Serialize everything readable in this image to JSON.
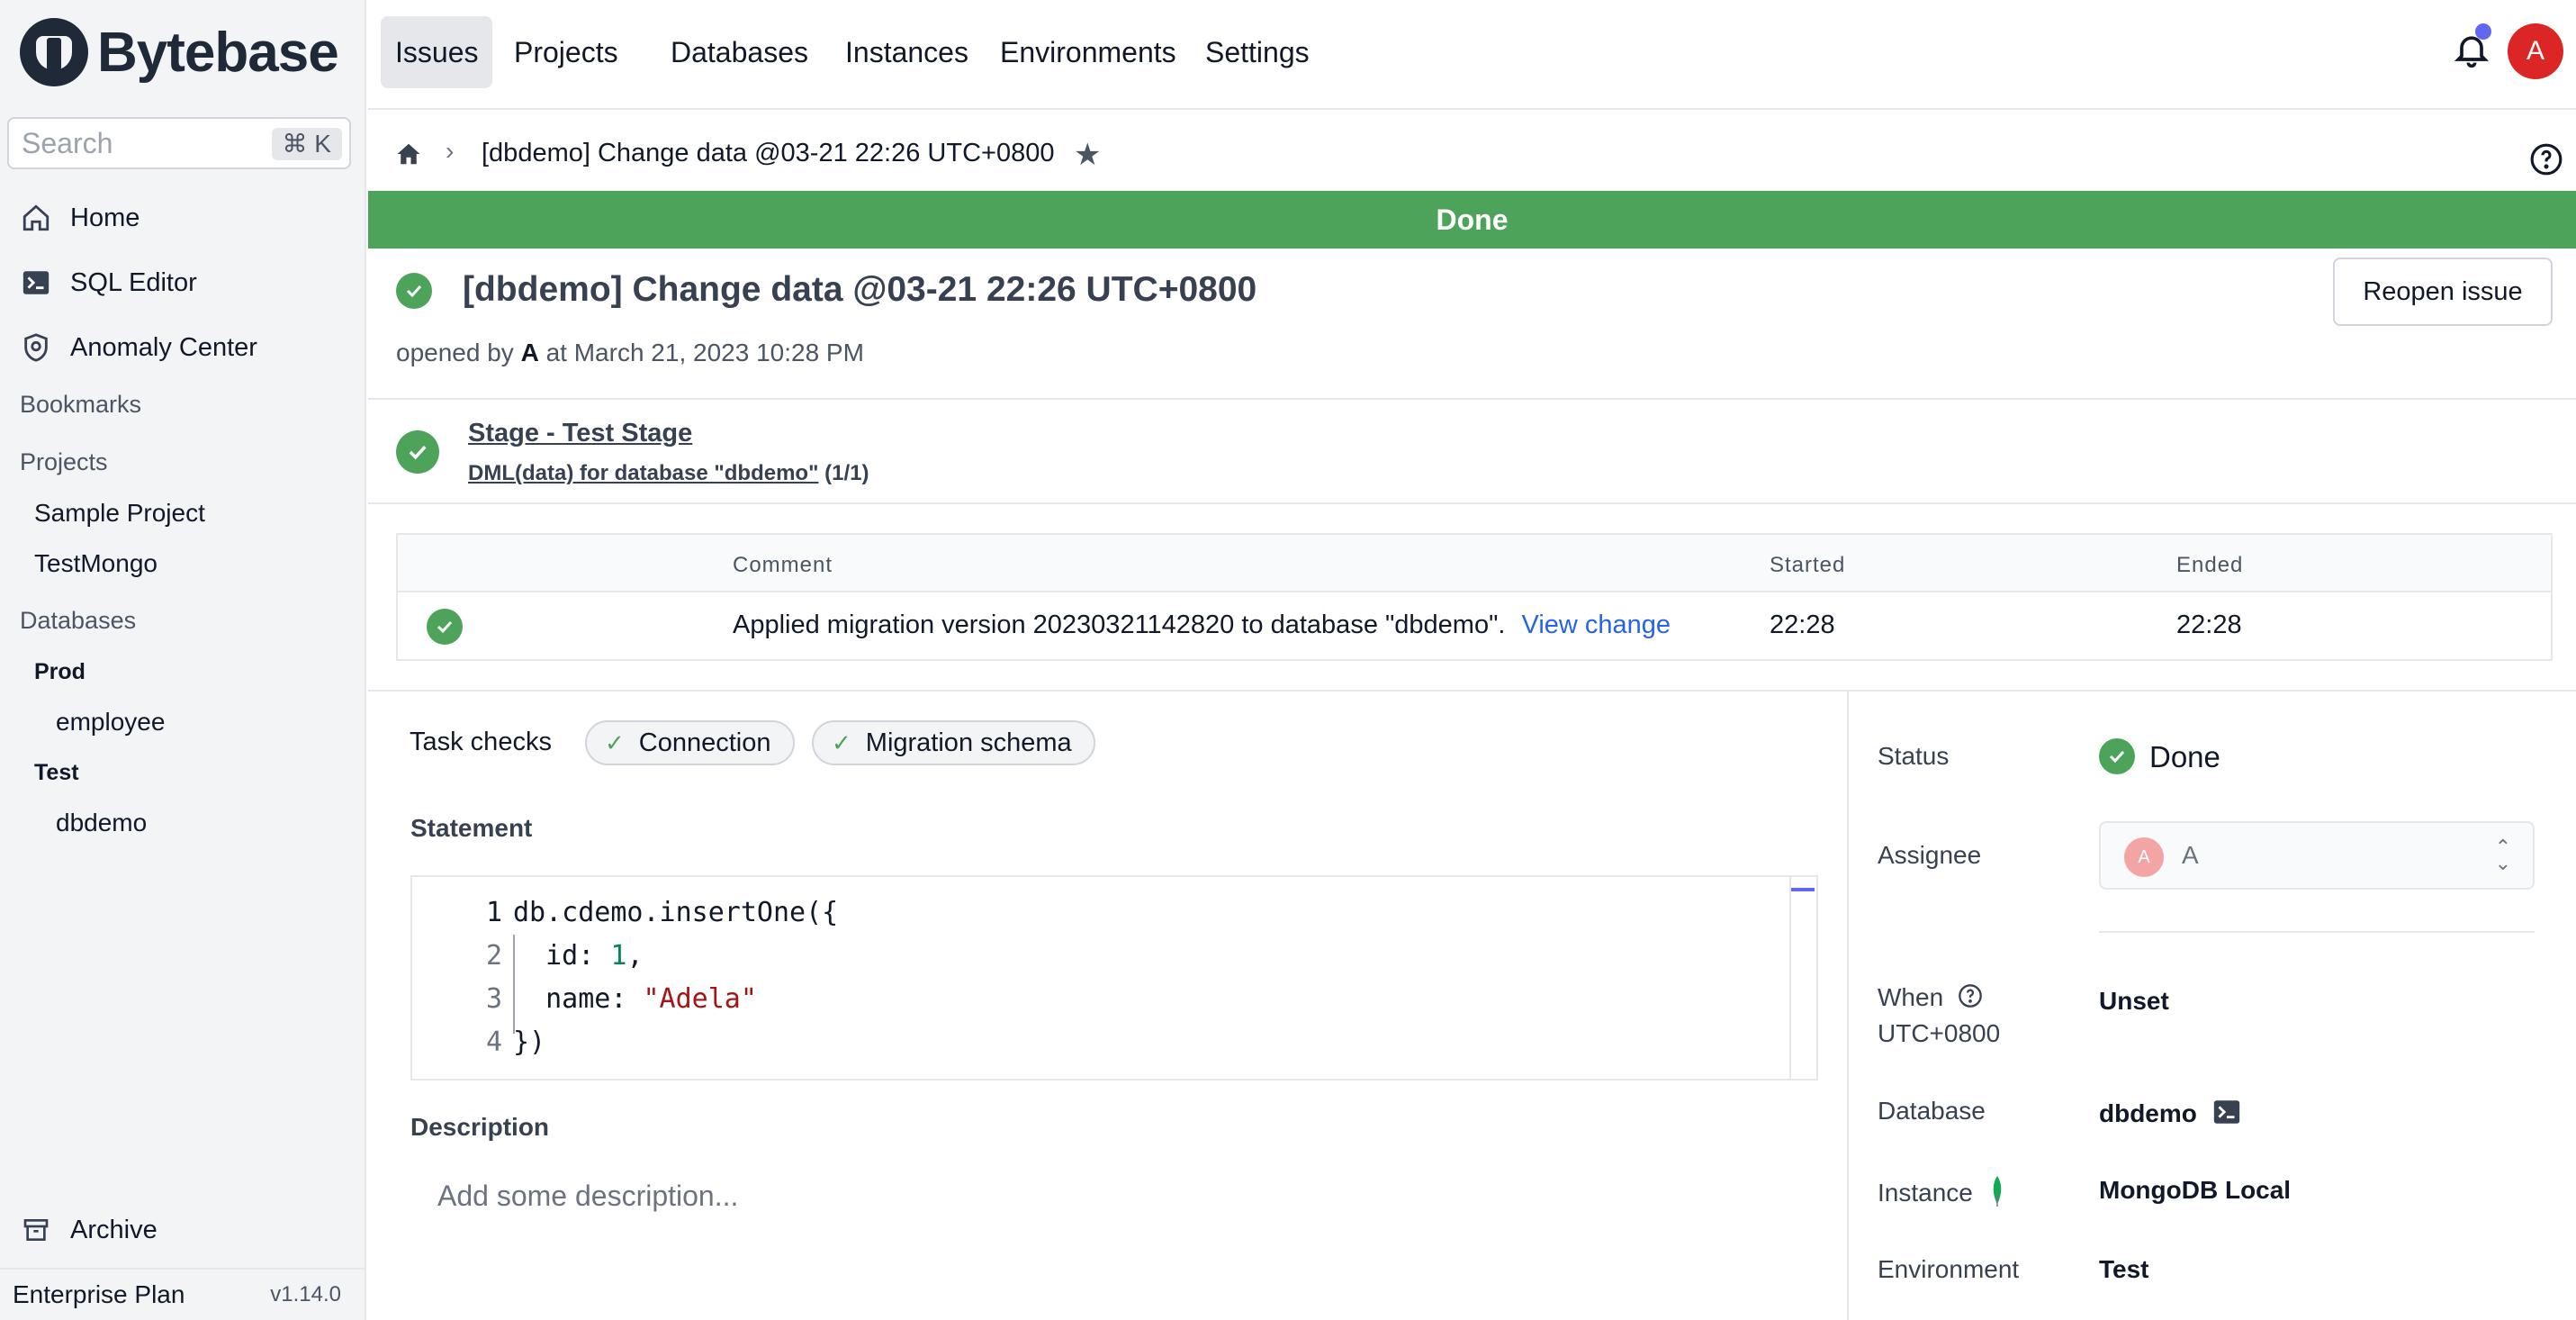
{
  "app": {
    "name": "Bytebase",
    "version": "v1.14.0",
    "plan": "Enterprise Plan"
  },
  "search": {
    "placeholder": "Search",
    "shortcut": "⌘ K"
  },
  "sidebar": {
    "nav": [
      {
        "label": "Home",
        "icon": "home-icon"
      },
      {
        "label": "SQL Editor",
        "icon": "terminal-icon"
      },
      {
        "label": "Anomaly Center",
        "icon": "shield-icon"
      }
    ],
    "bookmarks_label": "Bookmarks",
    "projects_label": "Projects",
    "projects": [
      "Sample Project",
      "TestMongo"
    ],
    "databases_label": "Databases",
    "environments": [
      {
        "name": "Prod",
        "databases": [
          "employee"
        ]
      },
      {
        "name": "Test",
        "databases": [
          "dbdemo"
        ]
      }
    ],
    "archive_label": "Archive"
  },
  "topnav": {
    "tabs": [
      "Issues",
      "Projects",
      "Databases",
      "Instances",
      "Environments",
      "Settings"
    ],
    "active": "Issues",
    "user_initial": "A"
  },
  "breadcrumb": {
    "title": "[dbdemo] Change data @03-21 22:26 UTC+0800"
  },
  "banner": {
    "status": "Done",
    "color": "#4ea35a"
  },
  "issue": {
    "title": "[dbdemo] Change data @03-21 22:26 UTC+0800",
    "opened_prefix": "opened by",
    "opened_by": "A",
    "opened_at": "at March 21, 2023 10:28 PM",
    "reopen_label": "Reopen issue"
  },
  "stage": {
    "title": "Stage - Test Stage",
    "task_link": "DML(data) for database \"dbdemo\"",
    "task_count": "(1/1)"
  },
  "task_table": {
    "headers": {
      "comment": "Comment",
      "started": "Started",
      "ended": "Ended"
    },
    "rows": [
      {
        "comment": "Applied migration version 20230321142820 to database \"dbdemo\".",
        "link": "View change",
        "started": "22:28",
        "ended": "22:28"
      }
    ]
  },
  "task_checks": {
    "label": "Task checks",
    "items": [
      "Connection",
      "Migration schema"
    ]
  },
  "statement": {
    "label": "Statement",
    "lines": [
      "db.cdemo.insertOne({",
      "  id: 1,",
      "  name: \"Adela\"",
      "})"
    ]
  },
  "description": {
    "label": "Description",
    "placeholder": "Add some description..."
  },
  "details": {
    "status_label": "Status",
    "status_value": "Done",
    "assignee_label": "Assignee",
    "assignee_value": "A",
    "when_label": "When",
    "when_tz": "UTC+0800",
    "when_value": "Unset",
    "database_label": "Database",
    "database_value": "dbdemo",
    "instance_label": "Instance",
    "instance_value": "MongoDB Local",
    "environment_label": "Environment",
    "environment_value": "Test"
  }
}
